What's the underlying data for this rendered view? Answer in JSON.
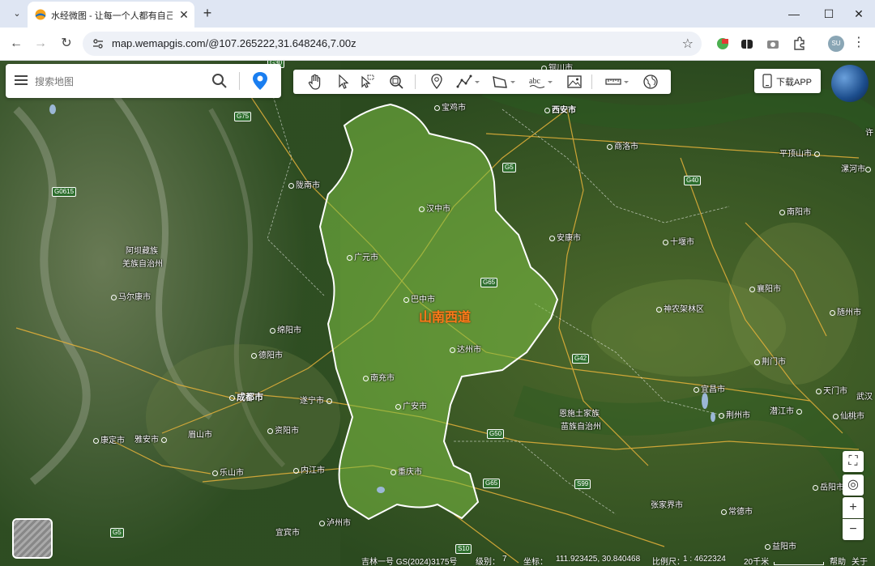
{
  "browser": {
    "tab_title": "水经微图 - 让每一个人都有自己",
    "url": "map.wemapgis.com/@107.265222,31.648246,7.00z",
    "profile_initials": "SU"
  },
  "search": {
    "placeholder": "搜索地图"
  },
  "download_label": "下载APP",
  "region_label": "山南西道",
  "region_color": "#7cc043",
  "cities": [
    {
      "name": "铜川市"
    },
    {
      "name": "宝鸡市"
    },
    {
      "name": "西安市"
    },
    {
      "name": "商洛市"
    },
    {
      "name": "平顶山市"
    },
    {
      "name": "漯河市"
    },
    {
      "name": "陇南市"
    },
    {
      "name": "汉中市"
    },
    {
      "name": "南阳市"
    },
    {
      "name": "安康市"
    },
    {
      "name": "十堰市"
    },
    {
      "name": "阿坝藏族"
    },
    {
      "name": "羌族自治州"
    },
    {
      "name": "广元市"
    },
    {
      "name": "马尔康市"
    },
    {
      "name": "巴中市"
    },
    {
      "name": "襄阳市"
    },
    {
      "name": "神农架林区"
    },
    {
      "name": "随州市"
    },
    {
      "name": "绵阳市"
    },
    {
      "name": "德阳市"
    },
    {
      "name": "达州市"
    },
    {
      "name": "荆门市"
    },
    {
      "name": "南充市"
    },
    {
      "name": "成都市"
    },
    {
      "name": "遂宁市"
    },
    {
      "name": "宜昌市"
    },
    {
      "name": "天门市"
    },
    {
      "name": "武汉"
    },
    {
      "name": "广安市"
    },
    {
      "name": "恩施土家族"
    },
    {
      "name": "苗族自治州"
    },
    {
      "name": "荆州市"
    },
    {
      "name": "潜江市"
    },
    {
      "name": "仙桃市"
    },
    {
      "name": "康定市"
    },
    {
      "name": "雅安市"
    },
    {
      "name": "眉山市"
    },
    {
      "name": "资阳市"
    },
    {
      "name": "乐山市"
    },
    {
      "name": "内江市"
    },
    {
      "name": "重庆市"
    },
    {
      "name": "岳阳市"
    },
    {
      "name": "张家界市"
    },
    {
      "name": "常德市"
    },
    {
      "name": "泸州市"
    },
    {
      "name": "宜宾市"
    },
    {
      "name": "益阳市"
    },
    {
      "name": "许"
    }
  ],
  "roads": [
    "G30",
    "G75",
    "G0615",
    "G5",
    "G40",
    "G65",
    "G42",
    "G50",
    "G65",
    "S99",
    "G5",
    "S10"
  ],
  "status": {
    "source": "吉林一号 GS(2024)3175号",
    "level_label": "级别：",
    "level": "7",
    "coords_label": "坐标：",
    "coords": "111.923425, 30.840468",
    "scale_label": "比例尺：",
    "scale": "1 : 4622324",
    "distance": "20千米",
    "help": "帮助",
    "about": "关于"
  },
  "icons": [
    "favicon",
    "close-icon",
    "plus-icon",
    "back-icon",
    "forward-icon",
    "reload-icon",
    "site-info-icon",
    "star-icon",
    "extension-icons",
    "menu-icon",
    "search-icon",
    "location-pin-icon",
    "hand-icon",
    "pointer-icon",
    "select-icon",
    "zoom-box-icon",
    "marker-icon",
    "polyline-icon",
    "polygon-icon",
    "text-icon",
    "image-icon",
    "ruler-icon",
    "globe-icon",
    "phone-icon",
    "fullscreen-icon",
    "locate-icon",
    "zoom-in-icon",
    "zoom-out-icon"
  ]
}
